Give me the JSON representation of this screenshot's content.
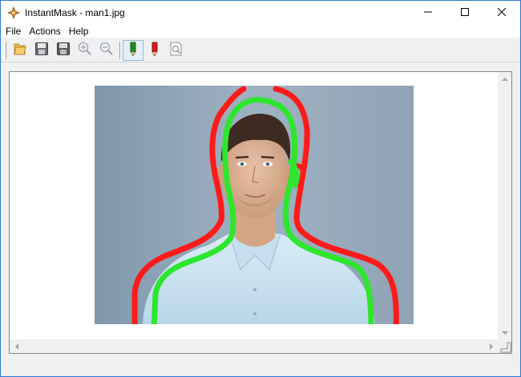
{
  "window": {
    "title": "InstantMask - man1.jpg",
    "icon": "instantmask-app-icon"
  },
  "titlebar_buttons": {
    "minimize": "minimize-icon",
    "maximize": "maximize-icon",
    "close": "close-icon"
  },
  "menu": {
    "items": [
      {
        "label": "File"
      },
      {
        "label": "Actions"
      },
      {
        "label": "Help"
      }
    ]
  },
  "toolbar": {
    "buttons": [
      {
        "icon": "open-folder-icon"
      },
      {
        "icon": "save-icon"
      },
      {
        "icon": "save-as-icon"
      },
      {
        "icon": "zoom-in-icon"
      },
      {
        "icon": "zoom-out-icon"
      },
      {
        "icon": "green-marker-icon",
        "state": "selected"
      },
      {
        "icon": "red-marker-icon"
      },
      {
        "icon": "preview-icon"
      }
    ]
  },
  "canvas": {
    "image_name": "man1.jpg",
    "strokes": {
      "foreground_color": "#2ee62e",
      "background_color": "#ff1a1a"
    }
  },
  "colors": {
    "titlebar_bg": "#ffffff",
    "window_border": "#2b79d6",
    "chrome_bg": "#f0f0f0"
  }
}
